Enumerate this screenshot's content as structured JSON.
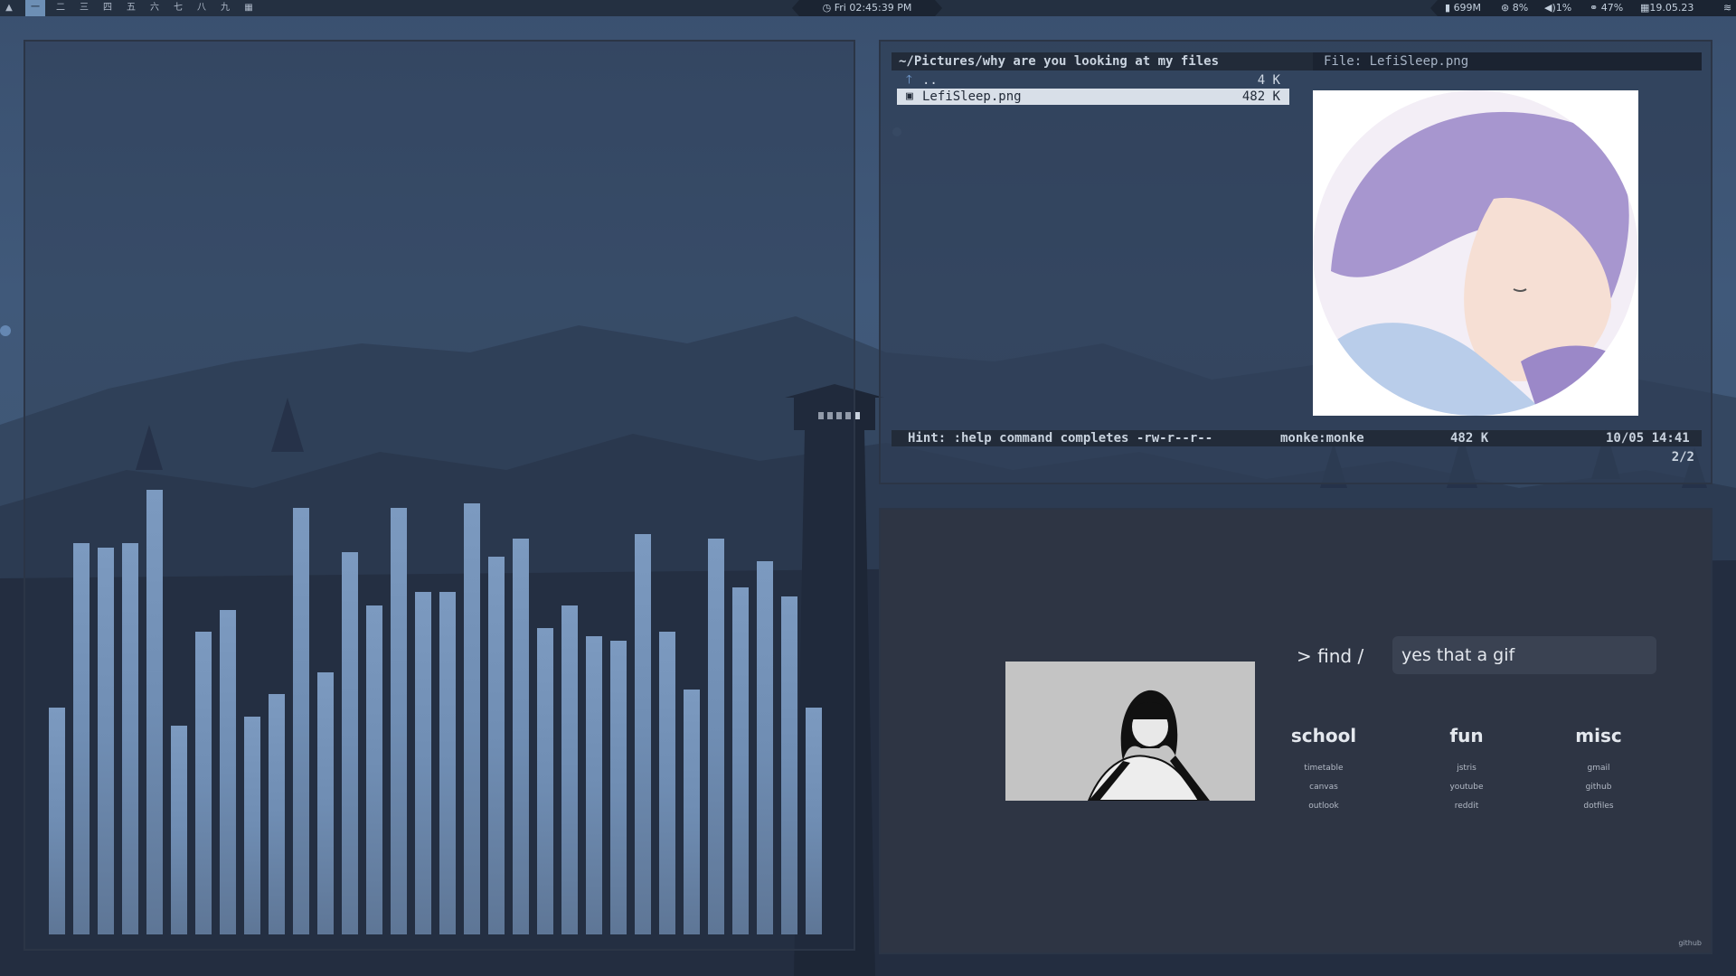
{
  "topbar": {
    "launcher_icon": "arch-icon",
    "workspaces": [
      "一",
      "二",
      "三",
      "四",
      "五",
      "六",
      "七",
      "八",
      "九"
    ],
    "active_workspace": 0,
    "layout_icon": "grid-icon",
    "clock": "Fri 02:45:39 PM",
    "memory": "699M",
    "cpu": "8%",
    "volume": "1%",
    "brightness": "47%",
    "date": "19.05.23"
  },
  "visualizer": {
    "bar_levels": [
      0.51,
      0.88,
      0.87,
      0.88,
      1.0,
      0.47,
      0.68,
      0.73,
      0.49,
      0.54,
      0.96,
      0.59,
      0.86,
      0.74,
      0.96,
      0.77,
      0.77,
      0.97,
      0.85,
      0.89,
      0.69,
      0.74,
      0.67,
      0.66,
      0.9,
      0.68,
      0.55,
      0.89,
      0.78,
      0.84,
      0.76,
      0.51
    ],
    "color": "#7592b8"
  },
  "file_manager": {
    "path": "~/Pictures/why are you looking at my files",
    "file_title": "File: LefiSleep.png",
    "rows": [
      {
        "icon": "arrow-up-icon",
        "name": "..",
        "size": "4 K"
      },
      {
        "icon": "image-file-icon",
        "name": "LefiSleep.png",
        "size": "482 K"
      }
    ],
    "status": {
      "hint": "Hint: :help command completes -rw-r--r--",
      "owner": "monke:monke",
      "size": "482 K",
      "date": "10/05 14:41"
    },
    "count": "2/2"
  },
  "startpage": {
    "prompt": "> find /",
    "search_value": "yes that a gif",
    "columns": [
      {
        "title": "school",
        "links": [
          "timetable",
          "canvas",
          "outlook"
        ]
      },
      {
        "title": "fun",
        "links": [
          "jstris",
          "youtube",
          "reddit"
        ]
      },
      {
        "title": "misc",
        "links": [
          "gmail",
          "github",
          "dotfiles"
        ]
      }
    ],
    "footer_link": "github"
  }
}
